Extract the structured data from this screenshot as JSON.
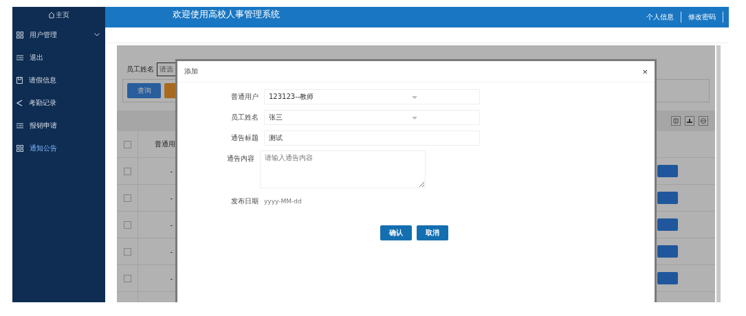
{
  "sidebar": {
    "home": "主页",
    "items": [
      {
        "label": "用户管理",
        "kind": "grid",
        "expandable": true,
        "selected": false
      },
      {
        "label": "退出",
        "kind": "list",
        "expandable": false,
        "selected": false
      },
      {
        "label": "请假信息",
        "kind": "doc",
        "expandable": false,
        "selected": false
      },
      {
        "label": "考勤记录",
        "kind": "share",
        "expandable": false,
        "selected": false
      },
      {
        "label": "报销申请",
        "kind": "list",
        "expandable": false,
        "selected": false
      },
      {
        "label": "通知公告",
        "kind": "grid",
        "expandable": false,
        "selected": true
      }
    ]
  },
  "header": {
    "title": "欢迎使用高校人事管理系统",
    "links": [
      "个人信息",
      "修改密码"
    ]
  },
  "list_page": {
    "search_label": "员工姓名",
    "search_placeholder": "请选",
    "search_button": "查询",
    "table": {
      "columns": [
        "普通用"
      ],
      "all_checked": false,
      "rows": [
        {
          "checked": false,
          "cells": [
            "-"
          ]
        },
        {
          "checked": false,
          "cells": [
            "-"
          ]
        },
        {
          "checked": false,
          "cells": [
            "-"
          ]
        },
        {
          "checked": false,
          "cells": [
            "-"
          ]
        },
        {
          "checked": false,
          "cells": [
            "-"
          ]
        }
      ]
    }
  },
  "dialog": {
    "title": "添加",
    "close": "×",
    "fields": [
      {
        "label": "普通用户",
        "kind": "select",
        "value": "123123--教师"
      },
      {
        "label": "员工姓名",
        "kind": "select",
        "value": "张三"
      },
      {
        "label": "通告标题",
        "kind": "text",
        "value": "测试"
      },
      {
        "label": "通告内容",
        "kind": "textarea",
        "placeholder": "请输入通告内容"
      },
      {
        "label": "发布日期",
        "kind": "date",
        "placeholder": "yyyy-MM-dd"
      }
    ],
    "buttons": [
      "确认",
      "取消"
    ]
  }
}
